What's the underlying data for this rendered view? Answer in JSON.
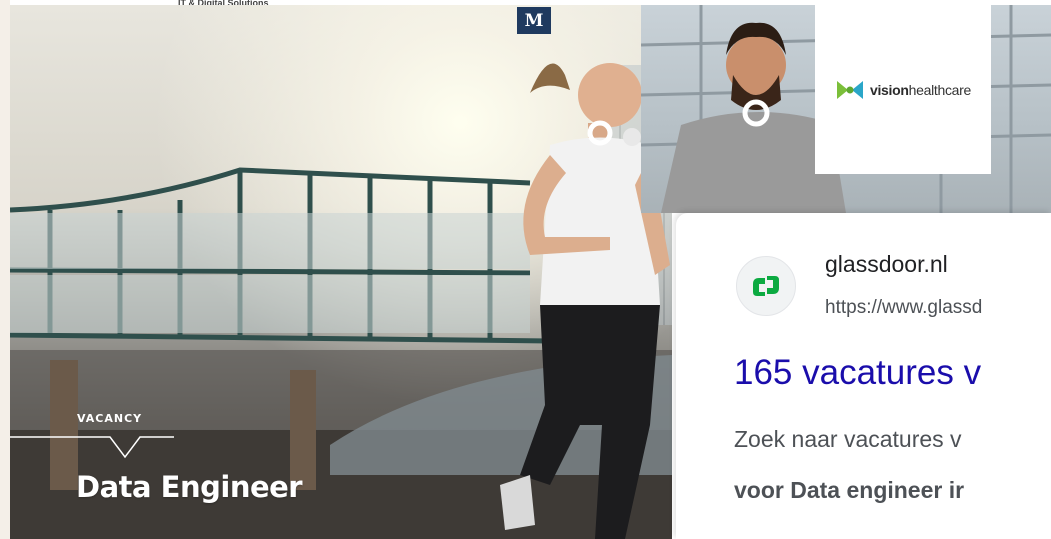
{
  "header": {
    "tagline": "IT & Digital Solutions",
    "logo_letter": "M"
  },
  "hero": {
    "vacancy_label": "VACANCY",
    "job_title": "Data Engineer"
  },
  "brand_card": {
    "name_bold": "vision",
    "name_regular": "healthcare",
    "logo_color": "#7bbf3a"
  },
  "search_result": {
    "site_name": "glassdoor.nl",
    "url": "https://www.glassd",
    "title": "165 vacatures v",
    "snippet_line1": "Zoek naar vacatures v",
    "snippet_line2": "voor Data engineer ir",
    "favicon": "glassdoor-icon",
    "title_color": "#1a0dab",
    "favicon_color": "#0caa41"
  }
}
